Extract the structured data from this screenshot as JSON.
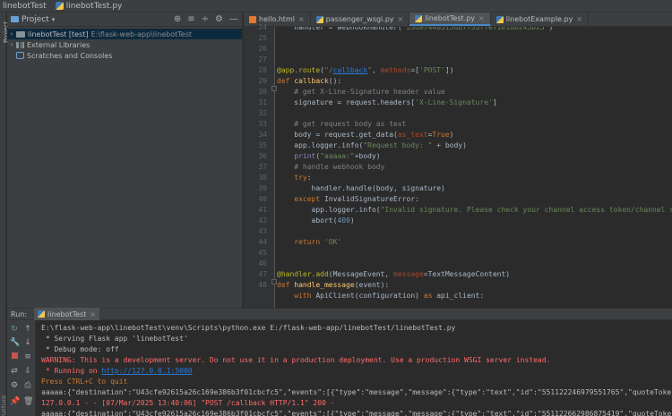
{
  "titlebar": {
    "project": "linebotTest",
    "file": "linebotTest.py"
  },
  "leftstrip": {
    "project_label": "Project",
    "structure_label": "Structure"
  },
  "project_panel": {
    "title": "Project",
    "tree": [
      {
        "label": "linebotTest [test]",
        "path": "E:\\flask-web-app\\linebotTest"
      },
      {
        "label": "External Libraries",
        "path": ""
      },
      {
        "label": "Scratches and Consoles",
        "path": ""
      }
    ]
  },
  "tabs": [
    {
      "label": "hello.html",
      "kind": "html"
    },
    {
      "label": "passenger_wsgi.py",
      "kind": "py"
    },
    {
      "label": "linebotTest.py",
      "kind": "py"
    },
    {
      "label": "linebotExample.py",
      "kind": "py"
    }
  ],
  "line_numbers": [
    "24",
    "25",
    "26",
    "27",
    "28",
    "29",
    "30",
    "31",
    "32",
    "33",
    "34",
    "35",
    "36",
    "37",
    "38",
    "39",
    "40",
    "41",
    "42",
    "43",
    "44",
    "45",
    "46",
    "47",
    "48"
  ],
  "run": {
    "label": "Run:",
    "tab": "linebotTest",
    "console": [
      "E:\\flask-web-app\\linebotTest\\venv\\Scripts\\python.exe E:/flask-web-app/linebotTest/linebotTest.py",
      " * Serving Flask app 'linebotTest'",
      " * Debug mode: off",
      "WARNING: This is a development server. Do not use it in a production deployment. Use a production WSGI server instead.",
      " * Running on ",
      "http://127.0.0.1:5000",
      "Press CTRL+C to quit",
      "aaaaa:{\"destination\":\"U43cfe92615a26c169e386b3f01cbcfc5\",\"events\":[{\"type\":\"message\",\"message\":{\"type\":\"text\",\"id\":\"551122246979551765\",\"quoteToken\":\"x52AldGKDIw",
      "127.0.0.1 - - [07/Mar/2025 13:40:06] \"POST /callback HTTP/1.1\" 200 -",
      "aaaaa:{\"destination\":\"U43cfe92615a26c169e386b3f01cbcfc5\",\"events\":[{\"type\":\"message\",\"message\":{\"type\":\"text\",\"id\":\"551122662986875419\",\"quoteToken\":\"1o7yEQIw"
    ]
  }
}
